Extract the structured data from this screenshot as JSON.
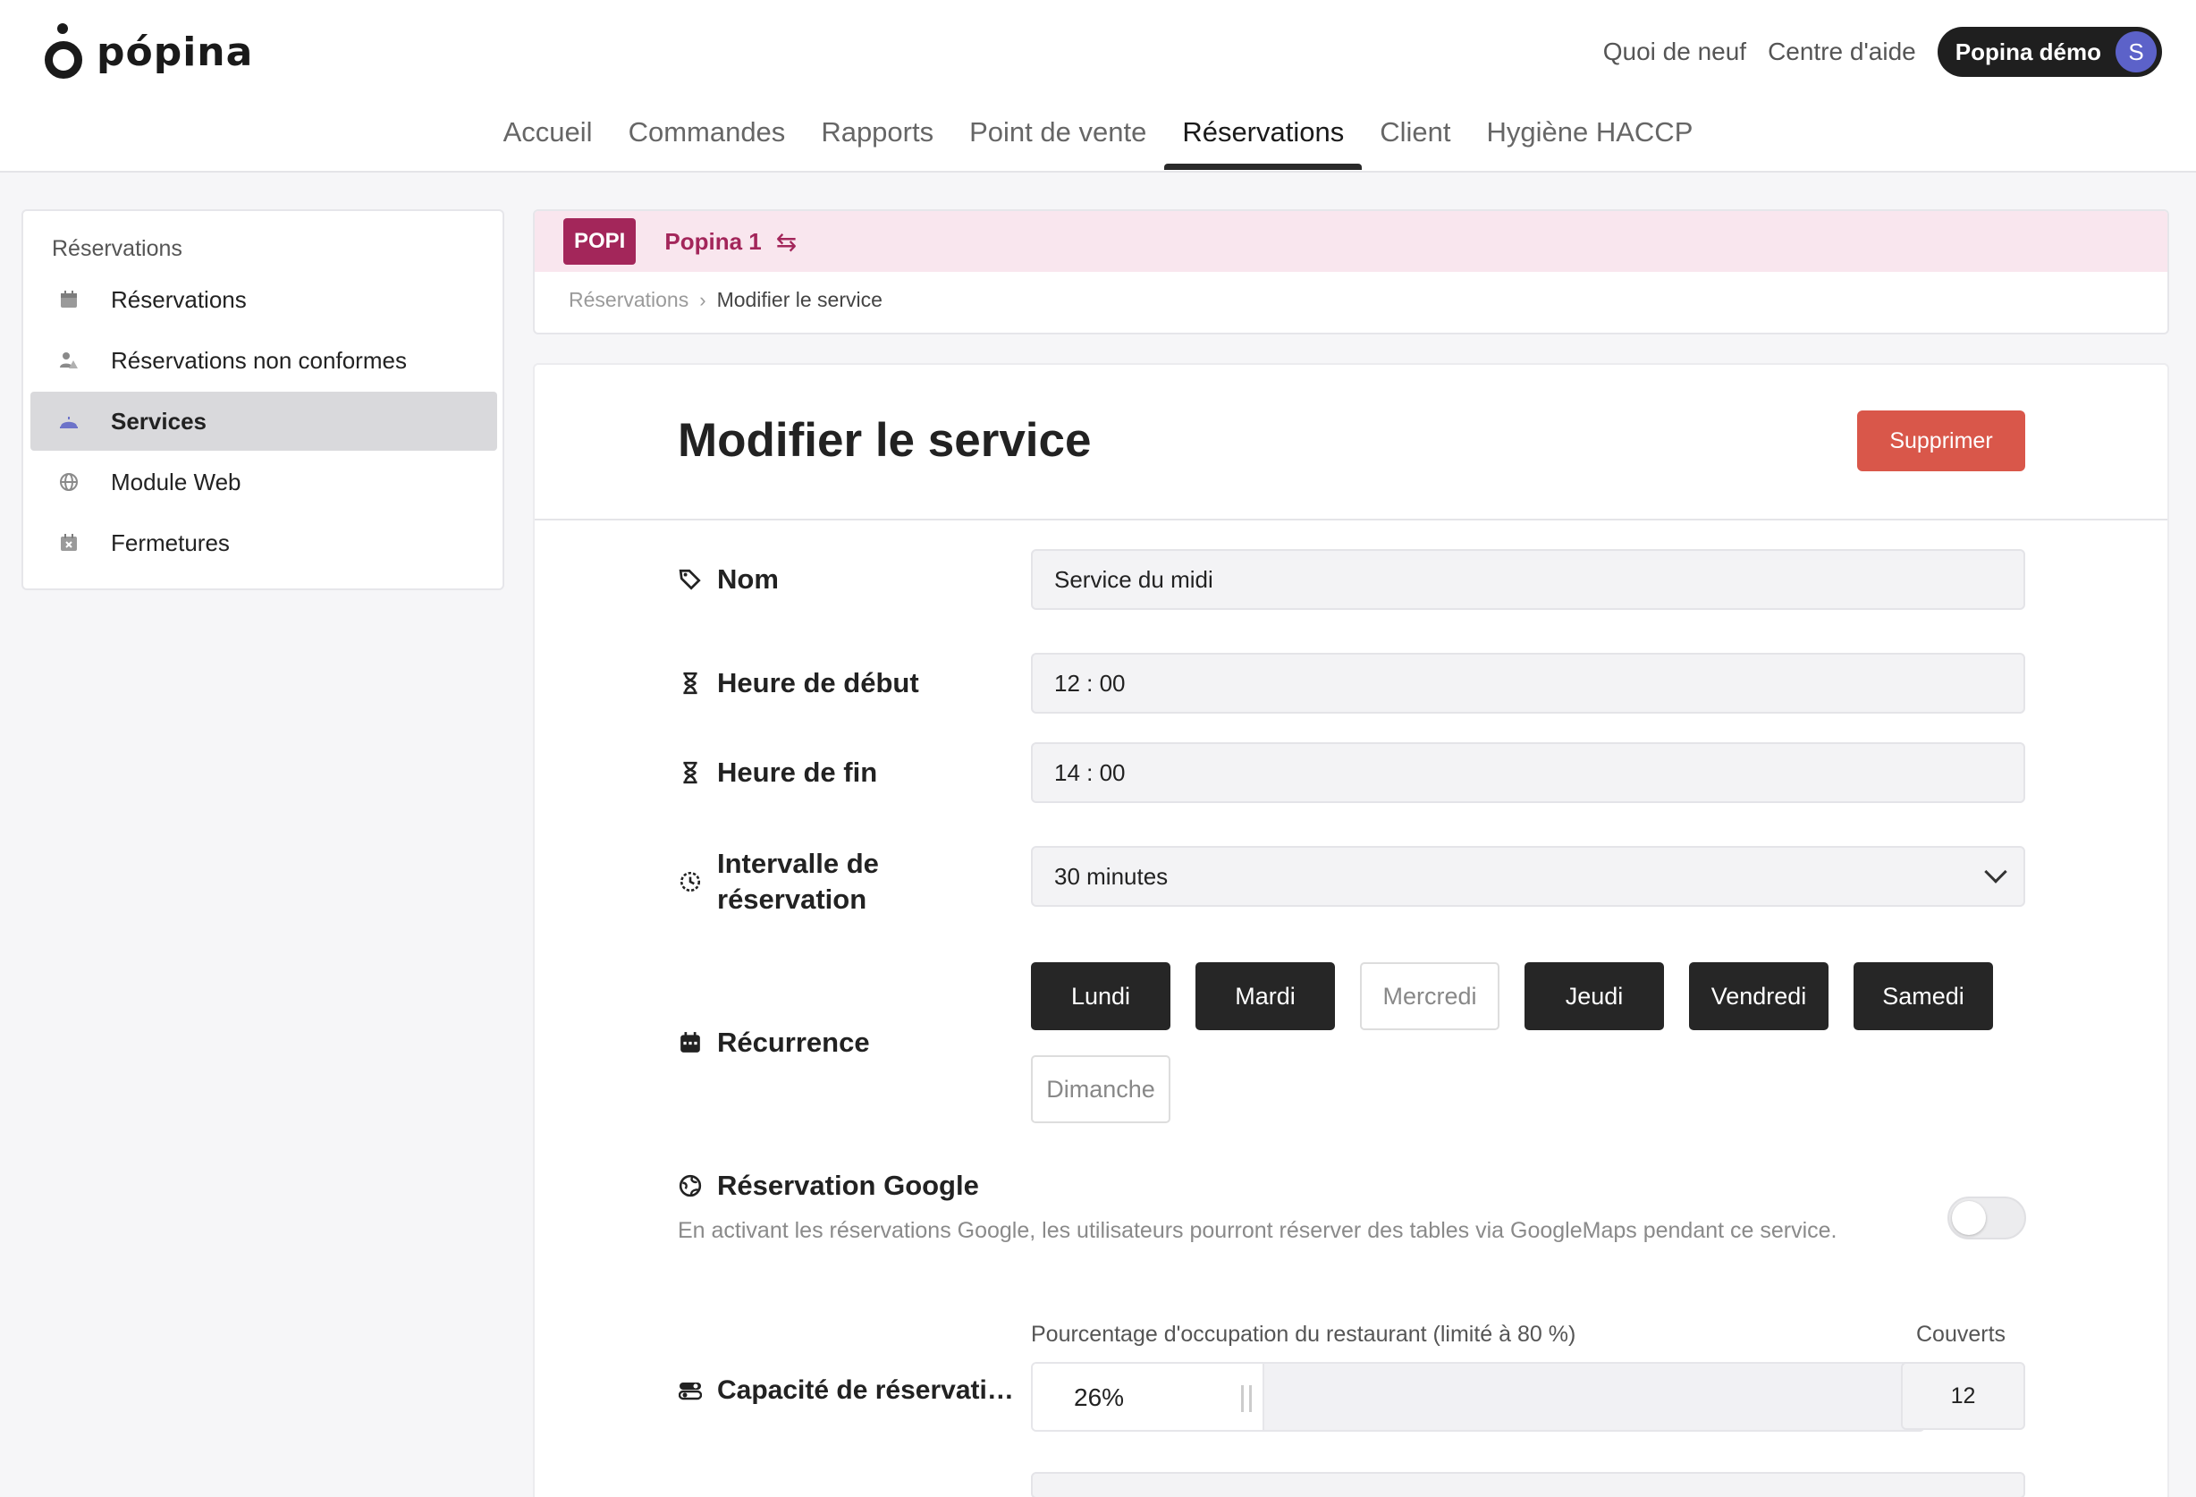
{
  "app": {
    "logo_text": "pópina",
    "top_links": [
      "Quoi de neuf",
      "Centre d'aide"
    ],
    "account_name": "Popina démo",
    "avatar_initial": "S"
  },
  "nav": {
    "items": [
      "Accueil",
      "Commandes",
      "Rapports",
      "Point de vente",
      "Réservations",
      "Client",
      "Hygiène HACCP"
    ],
    "active": "Réservations"
  },
  "sidebar": {
    "title": "Réservations",
    "items": [
      {
        "label": "Réservations",
        "icon": "calendar-icon"
      },
      {
        "label": "Réservations non conformes",
        "icon": "user-warning-icon"
      },
      {
        "label": "Services",
        "icon": "service-bell-icon"
      },
      {
        "label": "Module Web",
        "icon": "globe-icon"
      },
      {
        "label": "Fermetures",
        "icon": "calendar-x-icon"
      }
    ],
    "active": "Services"
  },
  "context": {
    "badge": "POPI",
    "store": "Popina 1",
    "breadcrumb": {
      "parent": "Réservations",
      "current": "Modifier le service"
    }
  },
  "form": {
    "title": "Modifier le service",
    "delete_label": "Supprimer",
    "name": {
      "label": "Nom",
      "value": "Service du midi"
    },
    "start": {
      "label": "Heure de début",
      "value": "12 : 00"
    },
    "end": {
      "label": "Heure de fin",
      "value": "14 : 00"
    },
    "interval": {
      "label_line1": "Intervalle de",
      "label_line2": "réservation",
      "value": "30 minutes"
    },
    "recurrence": {
      "label": "Récurrence",
      "days": [
        {
          "label": "Lundi",
          "selected": true
        },
        {
          "label": "Mardi",
          "selected": true
        },
        {
          "label": "Mercredi",
          "selected": false
        },
        {
          "label": "Jeudi",
          "selected": true
        },
        {
          "label": "Vendredi",
          "selected": true
        },
        {
          "label": "Samedi",
          "selected": true
        },
        {
          "label": "Dimanche",
          "selected": false
        }
      ]
    },
    "google": {
      "label": "Réservation Google",
      "description": "En activant les réservations Google, les utilisateurs pourront réserver des tables via GoogleMaps pendant ce service.",
      "enabled": false
    },
    "capacity": {
      "label": "Capacité de réservati…",
      "occupancy_label": "Pourcentage d'occupation du restaurant (limité à 80 %)",
      "occupancy_value": "26%",
      "occupancy_fraction": 0.26,
      "couverts_label": "Couverts",
      "couverts_value": "12"
    }
  },
  "colors": {
    "accent": "#a3265a",
    "delete": "#d9574a",
    "day_selected": "#262626",
    "avatar": "#5c62c9"
  }
}
